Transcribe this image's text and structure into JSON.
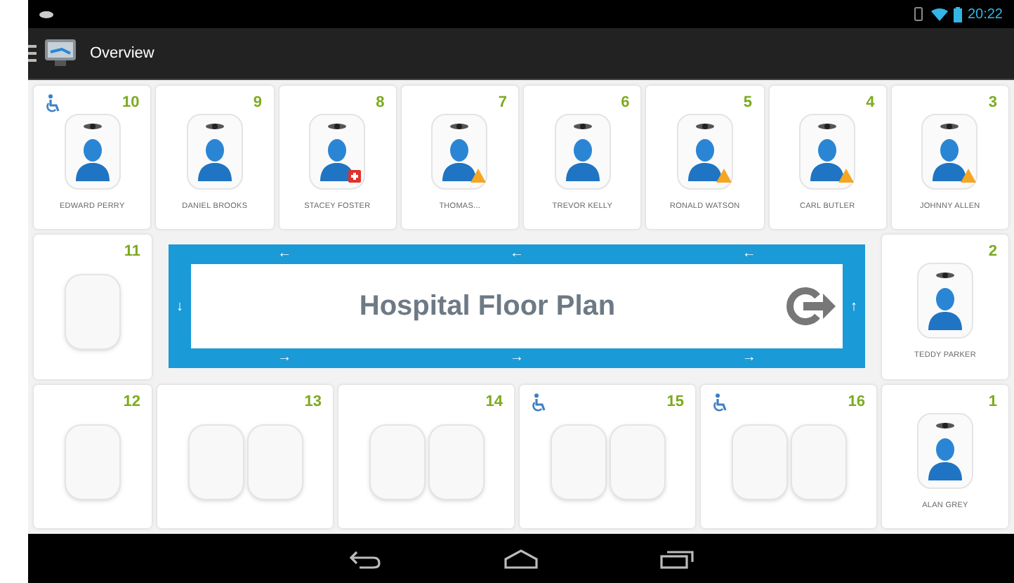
{
  "status_bar": {
    "time": "20:22"
  },
  "action_bar": {
    "title": "Overview"
  },
  "rows": [
    {
      "kind": "beds",
      "rooms": [
        {
          "number": "10",
          "accessible": true,
          "beds": [
            {
              "occupied": true,
              "name": "EDWARD PERRY",
              "warning": false,
              "critical": false
            }
          ]
        },
        {
          "number": "9",
          "accessible": false,
          "beds": [
            {
              "occupied": true,
              "name": "DANIEL BROOKS",
              "warning": false,
              "critical": false
            }
          ]
        },
        {
          "number": "8",
          "accessible": false,
          "beds": [
            {
              "occupied": true,
              "name": "STACEY FOSTER",
              "warning": false,
              "critical": true
            }
          ]
        },
        {
          "number": "7",
          "accessible": false,
          "beds": [
            {
              "occupied": true,
              "name": "THOMAS...",
              "warning": true,
              "critical": false
            }
          ]
        },
        {
          "number": "6",
          "accessible": false,
          "beds": [
            {
              "occupied": true,
              "name": "TREVOR KELLY",
              "warning": false,
              "critical": false
            }
          ]
        },
        {
          "number": "5",
          "accessible": false,
          "beds": [
            {
              "occupied": true,
              "name": "RONALD WATSON",
              "warning": true,
              "critical": false
            }
          ]
        },
        {
          "number": "4",
          "accessible": false,
          "beds": [
            {
              "occupied": true,
              "name": "CARL BUTLER",
              "warning": true,
              "critical": false
            }
          ]
        },
        {
          "number": "3",
          "accessible": false,
          "beds": [
            {
              "occupied": true,
              "name": "JOHNNY ALLEN",
              "warning": true,
              "critical": false
            }
          ]
        }
      ]
    },
    {
      "kind": "middle",
      "left": {
        "number": "11",
        "accessible": false,
        "beds": [
          {
            "occupied": false
          }
        ]
      },
      "floor_plan": {
        "title": "Hospital Floor Plan",
        "top_arrows": [
          "←",
          "←",
          "←"
        ],
        "bottom_arrows": [
          "→",
          "→",
          "→"
        ],
        "left_arrow": "↓",
        "right_arrow": "↑"
      },
      "right": {
        "number": "2",
        "accessible": false,
        "beds": [
          {
            "occupied": true,
            "name": "TEDDY PARKER",
            "warning": false,
            "critical": false
          }
        ]
      }
    },
    {
      "kind": "beds",
      "rooms": [
        {
          "number": "12",
          "accessible": false,
          "beds": [
            {
              "occupied": false
            }
          ]
        },
        {
          "number": "13",
          "accessible": false,
          "beds": [
            {
              "occupied": false
            },
            {
              "occupied": false
            }
          ]
        },
        {
          "number": "14",
          "accessible": false,
          "beds": [
            {
              "occupied": false
            },
            {
              "occupied": false
            }
          ]
        },
        {
          "number": "15",
          "accessible": true,
          "beds": [
            {
              "occupied": false
            },
            {
              "occupied": false
            }
          ]
        },
        {
          "number": "16",
          "accessible": true,
          "beds": [
            {
              "occupied": false
            },
            {
              "occupied": false
            }
          ]
        },
        {
          "number": "1",
          "accessible": false,
          "beds": [
            {
              "occupied": true,
              "name": "ALAN GREY",
              "warning": false,
              "critical": false
            }
          ]
        }
      ]
    }
  ]
}
